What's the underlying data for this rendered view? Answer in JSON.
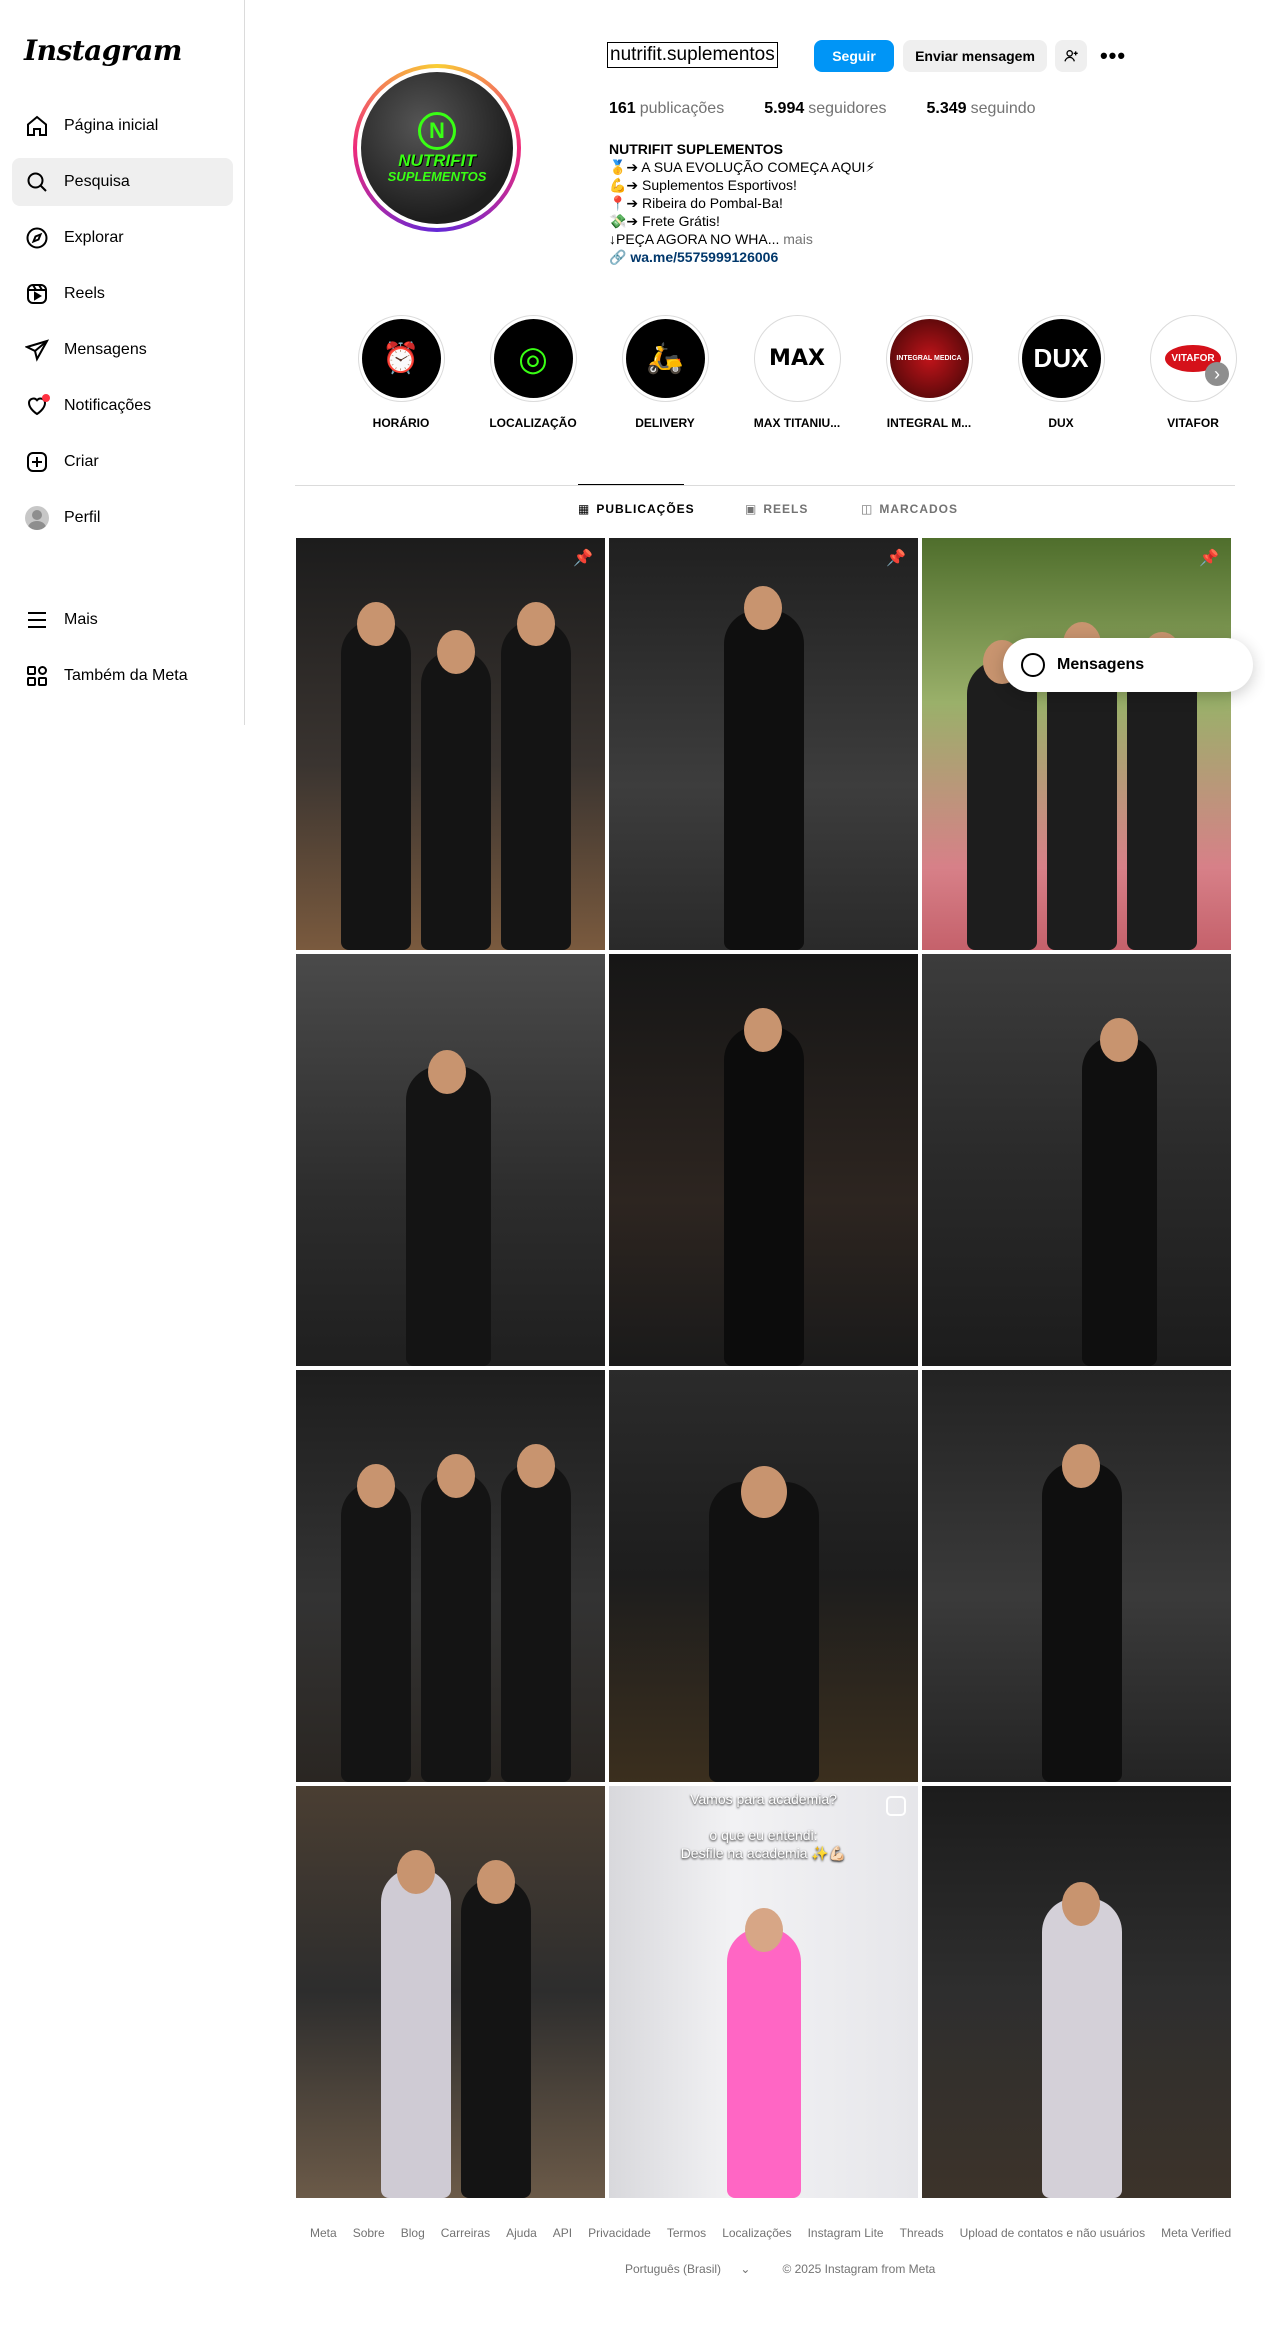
{
  "app": {
    "logo_text": "Instagram"
  },
  "sidebar": {
    "items": [
      {
        "label": "Página inicial",
        "icon": "home-icon"
      },
      {
        "label": "Pesquisa",
        "icon": "search-icon",
        "active": true
      },
      {
        "label": "Explorar",
        "icon": "compass-icon"
      },
      {
        "label": "Reels",
        "icon": "reels-icon"
      },
      {
        "label": "Mensagens",
        "icon": "send-icon"
      },
      {
        "label": "Notificações",
        "icon": "heart-icon"
      },
      {
        "label": "Criar",
        "icon": "plus-square-icon"
      },
      {
        "label": "Perfil",
        "icon": "avatar"
      }
    ],
    "more": [
      {
        "label": "Mais",
        "icon": "menu-icon"
      },
      {
        "label": "Também da Meta",
        "icon": "meta-apps-icon"
      }
    ]
  },
  "profile": {
    "username": "nutrifit.suplementos",
    "follow_label": "Seguir",
    "message_label": "Enviar mensagem",
    "stats": {
      "posts_count": "161",
      "posts_label": "publicações",
      "followers_count": "5.994",
      "followers_label": "seguidores",
      "following_count": "5.349",
      "following_label": "seguindo"
    },
    "avatar_text": {
      "line1": "NUTRIFIT",
      "line2": "SUPLEMENTOS",
      "letter": "N"
    },
    "bio": {
      "name": "NUTRIFIT SUPLEMENTOS",
      "line1": "🥇➔ A SUA EVOLUÇÃO COMEÇA AQUI⚡",
      "line2": "💪➔ Suplementos Esportivos!",
      "line3": "📍➔ Ribeira do Pombal-Ba!",
      "line4": "💸➔ Frete Grátis!",
      "line5": "↓PEÇA AGORA NO WHA...",
      "more": "mais",
      "link": "wa.me/5575999126006"
    }
  },
  "highlights": [
    {
      "label": "HORÁRIO",
      "bg": "#000000",
      "text": "⏰"
    },
    {
      "label": "LOCALIZAÇÃO",
      "bg": "#000000",
      "text": "◎"
    },
    {
      "label": "DELIVERY",
      "bg": "#000000",
      "text": "🛵"
    },
    {
      "label": "MAX TITANIU...",
      "bg": "#ffffff",
      "text": "MAX"
    },
    {
      "label": "INTEGRAL M...",
      "bg": "#7a0a0a",
      "text": "INTEGRAL MEDICA"
    },
    {
      "label": "DUX",
      "bg": "#000000",
      "text": "DUX"
    },
    {
      "label": "VITAFOR",
      "bg": "#ffffff",
      "text": "VITAFOR"
    }
  ],
  "tabs": [
    {
      "label": "PUBLICAÇÕES",
      "icon": "grid-icon",
      "active": true
    },
    {
      "label": "REELS",
      "icon": "reels-icon"
    },
    {
      "label": "MARCADOS",
      "icon": "tagged-icon"
    }
  ],
  "posts": [
    {
      "pinned": true
    },
    {
      "pinned": true
    },
    {
      "pinned": true
    },
    {},
    {},
    {},
    {},
    {},
    {},
    {},
    {
      "reel": true,
      "caption": "Vamos para academia?\n\no que eu entendi:\nDesfile na academia ✨💪🏻"
    },
    {}
  ],
  "floating_messages": {
    "label": "Mensagens"
  },
  "footer": {
    "links": [
      "Meta",
      "Sobre",
      "Blog",
      "Carreiras",
      "Ajuda",
      "API",
      "Privacidade",
      "Termos",
      "Localizações",
      "Instagram Lite",
      "Threads",
      "Upload de contatos e não usuários",
      "Meta Verified"
    ],
    "language": "Português (Brasil)",
    "copyright": "© 2025 Instagram from Meta"
  },
  "colors": {
    "accent": "#0095f6",
    "brand_green": "#39ff14",
    "muted": "#737373"
  }
}
